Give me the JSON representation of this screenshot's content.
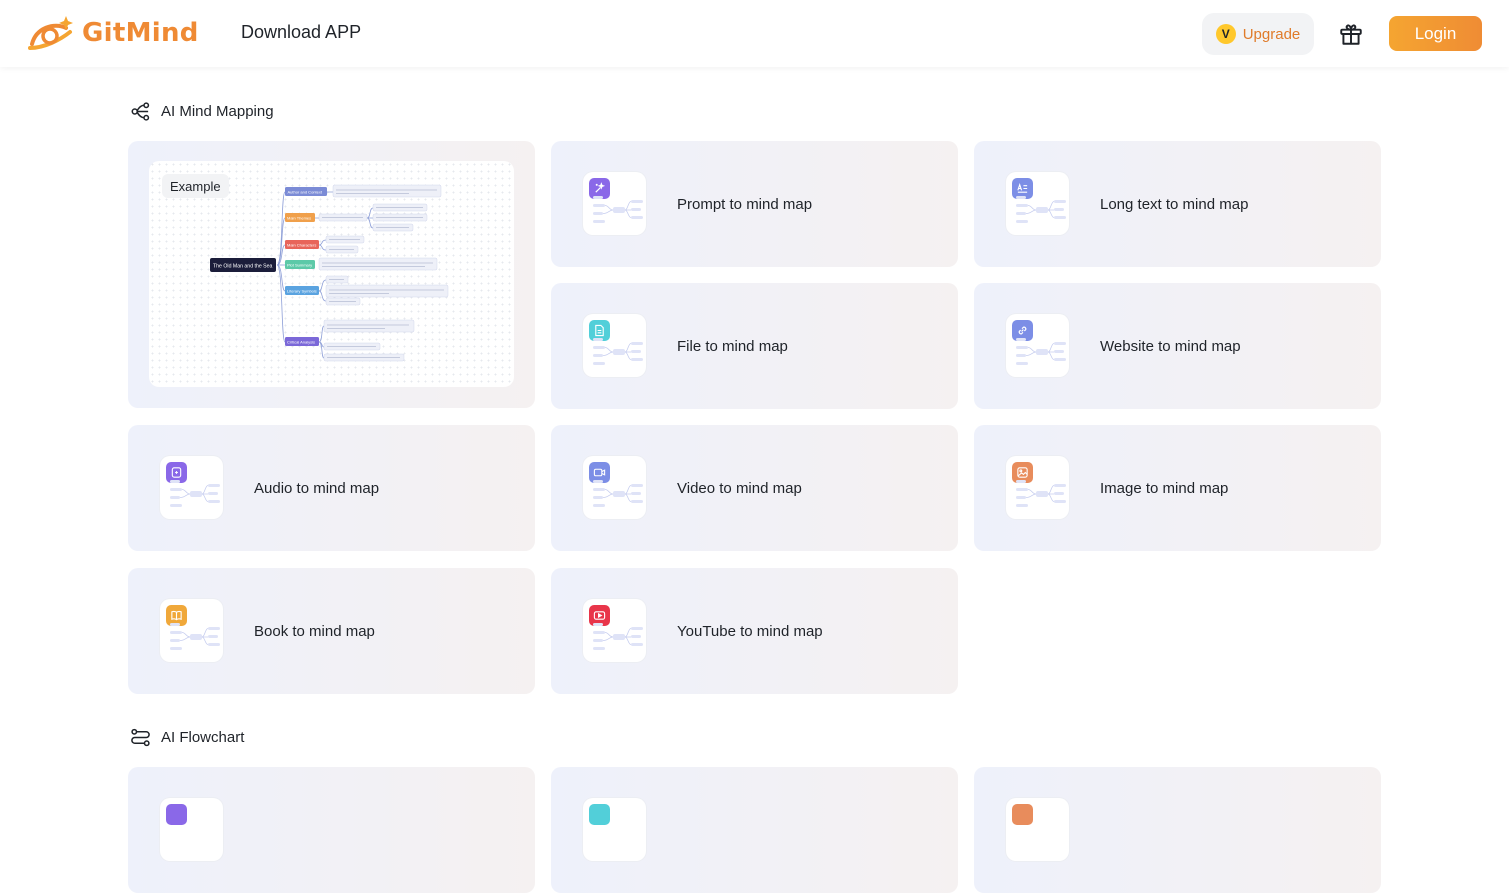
{
  "header": {
    "brand": "GitMind",
    "download_label": "Download APP",
    "upgrade_label": "Upgrade",
    "upgrade_badge": "V",
    "login_label": "Login",
    "accent_color": "#ef8a34"
  },
  "sections": {
    "mind_mapping": {
      "title": "AI Mind Mapping",
      "icon": "mind-map-icon",
      "example": {
        "tag": "Example",
        "root": "The Old Man and the Sea",
        "branches": [
          "Author and Context",
          "Main Themes",
          "Main Characters",
          "Plot Summary",
          "Literary Symbols",
          "Critical Analysis"
        ]
      },
      "cards": [
        {
          "label": "Prompt to mind map",
          "icon": "prompt-icon",
          "color": "#8a68e8"
        },
        {
          "label": "Long text to mind map",
          "icon": "long-text-icon",
          "color": "#7c8ee6"
        },
        {
          "label": "File to mind map",
          "icon": "file-icon",
          "color": "#52cfd9"
        },
        {
          "label": "Website to mind map",
          "icon": "link-icon",
          "color": "#7c8ee6"
        },
        {
          "label": "Audio to mind map",
          "icon": "audio-icon",
          "color": "#8a68e8"
        },
        {
          "label": "Video to mind map",
          "icon": "video-icon",
          "color": "#7c8ee6"
        },
        {
          "label": "Image to mind map",
          "icon": "image-icon",
          "color": "#e88c5c"
        },
        {
          "label": "Book to mind map",
          "icon": "book-icon",
          "color": "#f0a83a"
        },
        {
          "label": "YouTube to mind map",
          "icon": "youtube-icon",
          "color": "#e8354a"
        }
      ]
    },
    "flowchart": {
      "title": "AI Flowchart",
      "icon": "flowchart-icon",
      "card_colors": [
        "#8a68e8",
        "#52cfd9",
        "#e88c5c"
      ]
    }
  }
}
